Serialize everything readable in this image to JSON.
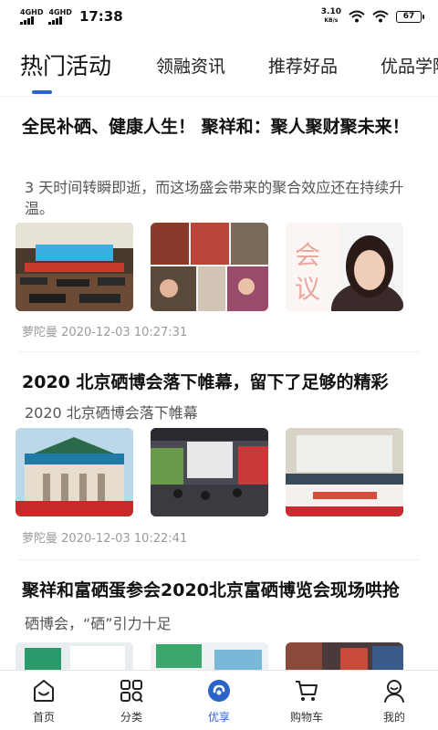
{
  "status_bar": {
    "net1": "4GHD",
    "net2": "4GHD",
    "time": "17:38",
    "speed": "3.10",
    "speed_unit": "KB/s",
    "battery": "67"
  },
  "tabs": [
    {
      "label": "热门活动",
      "active": true
    },
    {
      "label": "领融资讯",
      "active": false
    },
    {
      "label": "推荐好品",
      "active": false
    },
    {
      "label": "优品学院",
      "active": false
    }
  ],
  "accent_color": "#2c63c8",
  "articles": [
    {
      "title": "全民补硒、健康人生！ 聚祥和：聚人聚财聚未来！",
      "summary": "3 天时间转瞬即逝，而这场盛会带来的聚合效应还在持续升温。",
      "author": "萝陀曼",
      "datetime": "2020-12-03 10:27:31",
      "images": [
        "conference-hall-photo",
        "event-collage-photo",
        "woman-portrait-photo"
      ]
    },
    {
      "title": "2020 北京硒博会落下帷幕，留下了足够的精彩",
      "summary": "2020 北京硒博会落下帷幕",
      "author": "萝陀曼",
      "datetime": "2020-12-03 10:22:41",
      "images": [
        "exhibition-building-photo",
        "exhibition-hall-photo",
        "stage-group-photo"
      ]
    },
    {
      "title": "聚祥和富硒蛋参会2020北京富硒博览会现场哄抢",
      "summary": "硒博会，“硒”引力十足",
      "author": "",
      "datetime": "",
      "images": [
        "booth-photo",
        "booth-display-photo",
        "crowd-photo"
      ]
    }
  ],
  "bottom_nav": [
    {
      "label": "首页",
      "icon": "home-icon",
      "active": false
    },
    {
      "label": "分类",
      "icon": "category-icon",
      "active": false
    },
    {
      "label": "优享",
      "icon": "youxiang-icon",
      "active": true
    },
    {
      "label": "购物车",
      "icon": "cart-icon",
      "active": false
    },
    {
      "label": "我的",
      "icon": "profile-icon",
      "active": false
    }
  ]
}
